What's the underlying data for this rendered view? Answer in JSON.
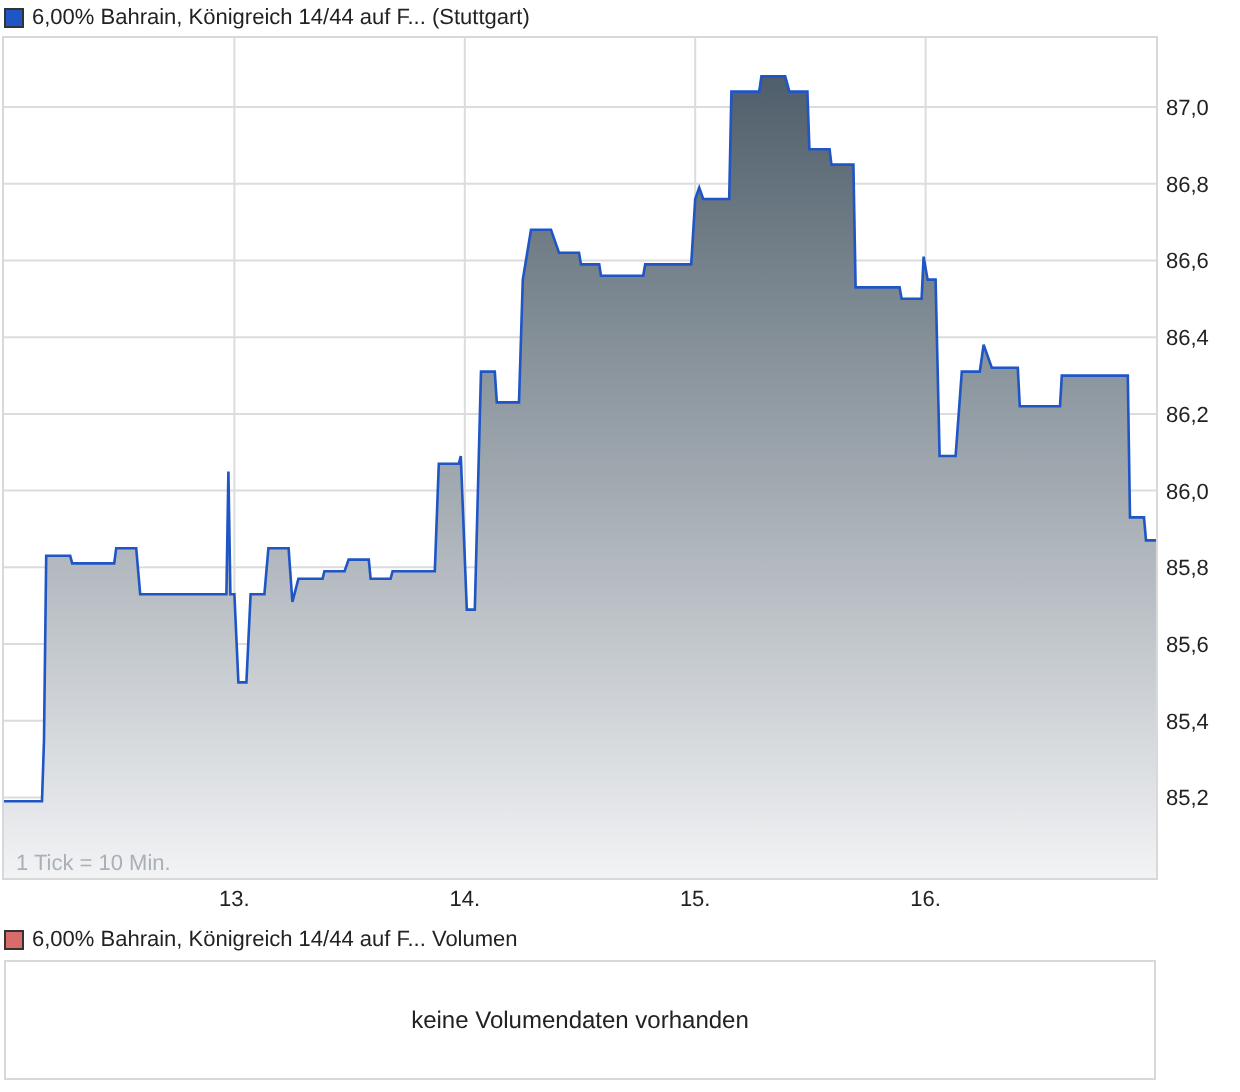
{
  "price_chart": {
    "tick_note": "1 Tick = 10 Min.",
    "chart_data": {
      "type": "area",
      "grid": true,
      "xlim": [
        12,
        17
      ],
      "ylim": [
        84.99,
        87.18
      ],
      "xticks": [
        {
          "value": 13,
          "label": "13."
        },
        {
          "value": 14,
          "label": "14."
        },
        {
          "value": 15,
          "label": "15."
        },
        {
          "value": 16,
          "label": "16."
        }
      ],
      "yticks": [
        {
          "value": 85.2,
          "label": "85,2"
        },
        {
          "value": 85.4,
          "label": "85,4"
        },
        {
          "value": 85.6,
          "label": "85,6"
        },
        {
          "value": 85.8,
          "label": "85,8"
        },
        {
          "value": 86.0,
          "label": "86,0"
        },
        {
          "value": 86.2,
          "label": "86,2"
        },
        {
          "value": 86.4,
          "label": "86,4"
        },
        {
          "value": 86.6,
          "label": "86,6"
        },
        {
          "value": 86.8,
          "label": "86,8"
        },
        {
          "value": 87.0,
          "label": "87,0"
        }
      ],
      "x": [
        12.0,
        12.165,
        12.174,
        12.183,
        12.287,
        12.296,
        12.478,
        12.487,
        12.574,
        12.591,
        12.965,
        12.974,
        12.983,
        13.0,
        13.017,
        13.052,
        13.07,
        13.13,
        13.148,
        13.235,
        13.252,
        13.278,
        13.383,
        13.391,
        13.478,
        13.496,
        13.583,
        13.591,
        13.678,
        13.687,
        13.87,
        13.887,
        13.974,
        13.983,
        14.009,
        14.043,
        14.07,
        14.13,
        14.139,
        14.235,
        14.252,
        14.287,
        14.374,
        14.409,
        14.496,
        14.504,
        14.583,
        14.591,
        14.774,
        14.783,
        14.983,
        15.0,
        15.017,
        15.035,
        15.148,
        15.157,
        15.278,
        15.287,
        15.391,
        15.409,
        15.487,
        15.496,
        15.583,
        15.591,
        15.687,
        15.696,
        15.887,
        15.896,
        15.983,
        15.991,
        16.009,
        16.043,
        16.061,
        16.13,
        16.157,
        16.235,
        16.252,
        16.287,
        16.4,
        16.409,
        16.583,
        16.591,
        16.878,
        16.887,
        16.948,
        16.957,
        17.0
      ],
      "series": [
        {
          "name": "6,00% Bahrain, Königreich 14/44 auf F... (Stuttgart)",
          "color": "#1f55c4",
          "values": [
            85.19,
            85.19,
            85.35,
            85.83,
            85.83,
            85.81,
            85.81,
            85.85,
            85.85,
            85.73,
            85.73,
            86.05,
            85.73,
            85.73,
            85.5,
            85.5,
            85.73,
            85.73,
            85.85,
            85.85,
            85.71,
            85.77,
            85.77,
            85.79,
            85.79,
            85.82,
            85.82,
            85.77,
            85.77,
            85.79,
            85.79,
            86.07,
            86.07,
            86.09,
            85.69,
            85.69,
            86.31,
            86.31,
            86.23,
            86.23,
            86.55,
            86.68,
            86.68,
            86.62,
            86.62,
            86.59,
            86.59,
            86.56,
            86.56,
            86.59,
            86.59,
            86.76,
            86.79,
            86.76,
            86.76,
            87.04,
            87.04,
            87.08,
            87.08,
            87.04,
            87.04,
            86.89,
            86.89,
            86.85,
            86.85,
            86.53,
            86.53,
            86.5,
            86.5,
            86.61,
            86.55,
            86.55,
            86.09,
            86.09,
            86.31,
            86.31,
            86.38,
            86.32,
            86.32,
            86.22,
            86.22,
            86.3,
            86.3,
            85.93,
            85.93,
            85.87,
            85.87
          ]
        }
      ]
    }
  },
  "volume_chart": {
    "legend": "6,00% Bahrain, Königreich 14/44 auf F... Volumen",
    "message": "keine Volumendaten vorhanden"
  }
}
